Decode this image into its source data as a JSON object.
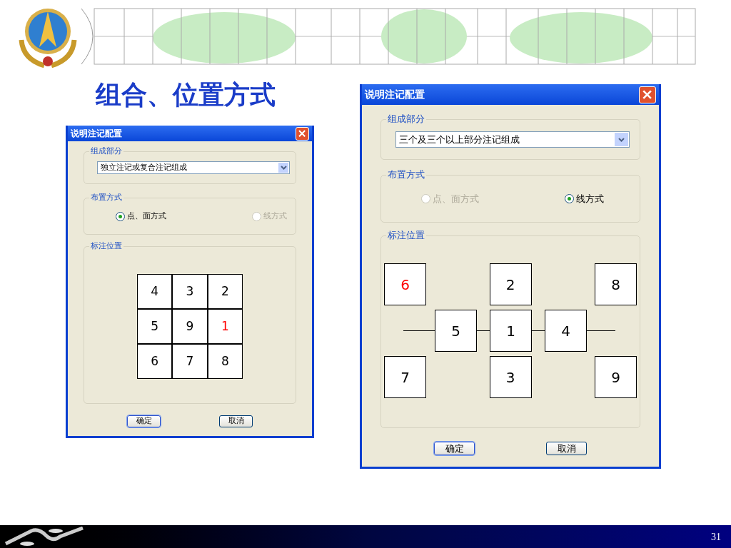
{
  "slide": {
    "title": "组合、位置方式",
    "page_number": "31"
  },
  "dialogs": [
    {
      "title": "说明注记配置",
      "composition": {
        "label": "组成部分",
        "value": "独立注记或复合注记组成"
      },
      "layout": {
        "label": "布置方式",
        "options": [
          {
            "label": "点、面方式",
            "selected": true,
            "disabled": false
          },
          {
            "label": "线方式",
            "selected": false,
            "disabled": true
          }
        ]
      },
      "position": {
        "label": "标注位置",
        "kind": "grid",
        "cells": [
          {
            "label": "4",
            "highlighted": false
          },
          {
            "label": "3",
            "highlighted": false
          },
          {
            "label": "2",
            "highlighted": false
          },
          {
            "label": "5",
            "highlighted": false
          },
          {
            "label": "9",
            "highlighted": false
          },
          {
            "label": "1",
            "highlighted": true
          },
          {
            "label": "6",
            "highlighted": false
          },
          {
            "label": "7",
            "highlighted": false
          },
          {
            "label": "8",
            "highlighted": false
          }
        ]
      },
      "buttons": [
        {
          "label": "确定",
          "default": true
        },
        {
          "label": "取消",
          "default": false
        }
      ]
    },
    {
      "title": "说明注记配置",
      "composition": {
        "label": "组成部分",
        "value": "三个及三个以上部分注记组成"
      },
      "layout": {
        "label": "布置方式",
        "options": [
          {
            "label": "点、面方式",
            "selected": false,
            "disabled": true
          },
          {
            "label": "线方式",
            "selected": true,
            "disabled": false
          }
        ]
      },
      "position": {
        "label": "标注位置",
        "kind": "line",
        "cells": [
          {
            "label": "6",
            "highlighted": true
          },
          {
            "label": "2",
            "highlighted": false
          },
          {
            "label": "8",
            "highlighted": false
          },
          {
            "label": "5",
            "highlighted": false
          },
          {
            "label": "1",
            "highlighted": false
          },
          {
            "label": "4",
            "highlighted": false
          },
          {
            "label": "7",
            "highlighted": false
          },
          {
            "label": "3",
            "highlighted": false
          },
          {
            "label": "9",
            "highlighted": false
          }
        ]
      },
      "buttons": [
        {
          "label": "确定",
          "default": true
        },
        {
          "label": "取消",
          "default": false
        }
      ]
    }
  ]
}
